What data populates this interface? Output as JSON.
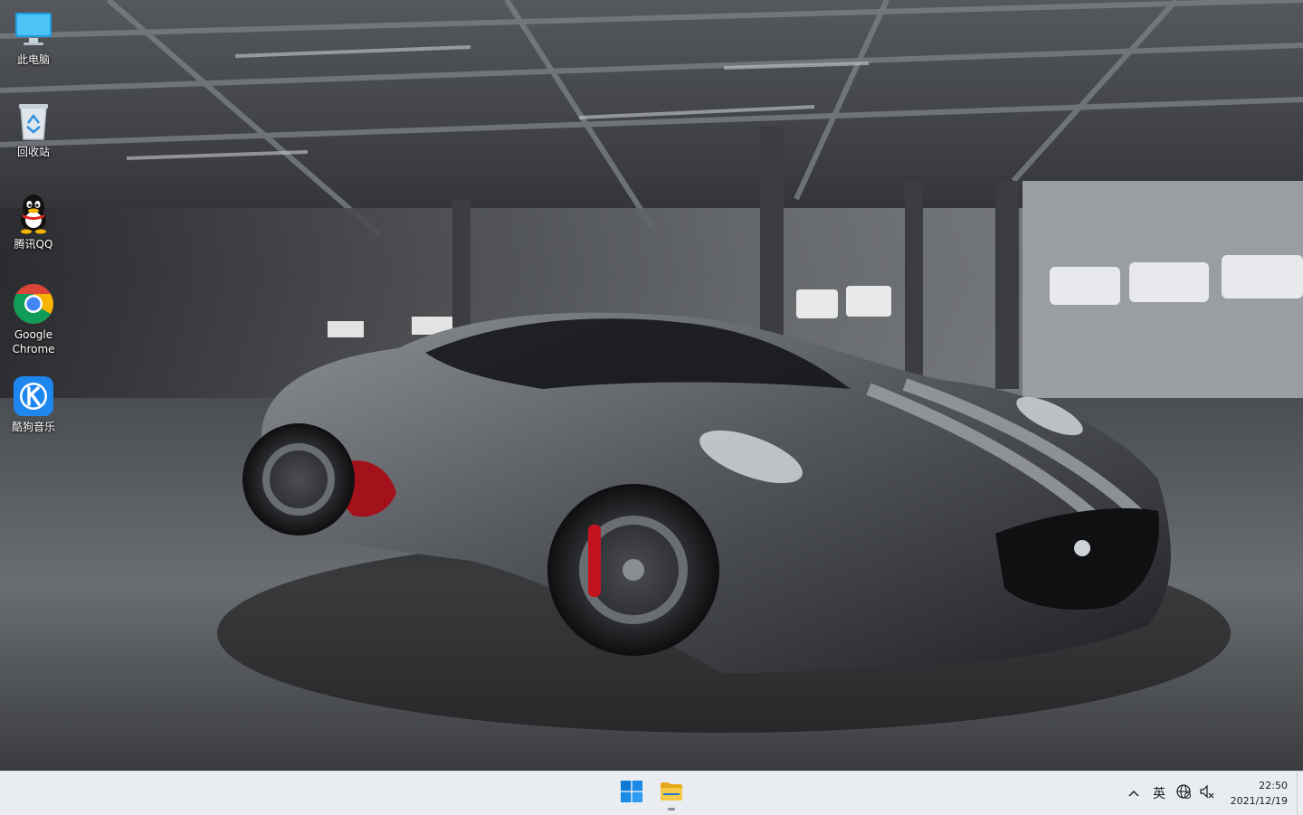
{
  "desktop": {
    "icons": [
      {
        "label": "此电脑",
        "icon": "monitor-icon"
      },
      {
        "label": "回收站",
        "icon": "recycle-bin-icon"
      },
      {
        "label": "腾讯QQ",
        "icon": "qq-penguin-icon"
      },
      {
        "label": "Google\nChrome",
        "icon": "chrome-icon"
      },
      {
        "label": "酷狗音乐",
        "icon": "kugou-music-icon"
      }
    ],
    "wallpaper": "garage-sports-car"
  },
  "taskbar": {
    "pinned": [
      {
        "name": "Start",
        "icon": "windows-start-icon",
        "active": false
      },
      {
        "name": "File Explorer",
        "icon": "file-explorer-icon",
        "active": true
      }
    ],
    "tray": {
      "overflow_icon": "chevron-up-icon",
      "ime": "英",
      "network_icon": "globe-network-icon",
      "volume_icon": "speaker-muted-icon"
    },
    "clock": {
      "time": "22:50",
      "date": "2021/12/19"
    },
    "colors": {
      "background": "#e9edf1",
      "start_blue": "#0f78d4",
      "folder_yellow": "#f7c948"
    }
  }
}
